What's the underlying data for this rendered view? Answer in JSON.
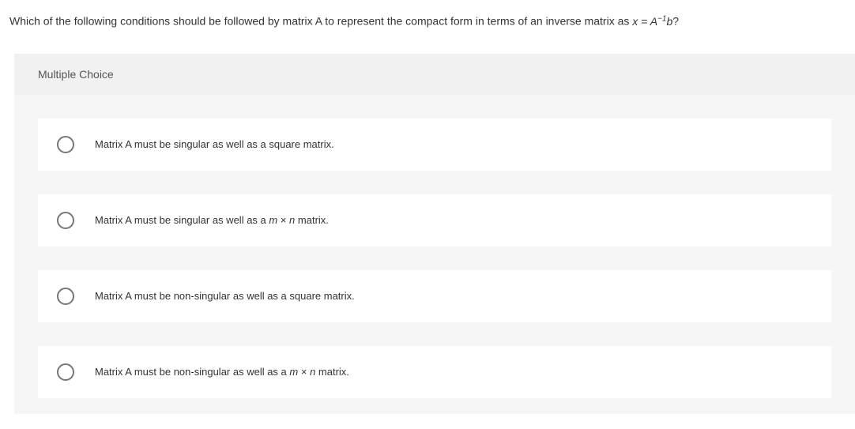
{
  "question": {
    "prefix": "Which of the following conditions should be followed by matrix A to represent the compact form in terms of an inverse matrix as ",
    "formula_x": "x",
    "formula_eq": " = ",
    "formula_A": "A",
    "formula_exp": "−1",
    "formula_b": "b",
    "suffix": "?"
  },
  "mc_label": "Multiple Choice",
  "options": [
    {
      "text": "Matrix A must be singular as well as a square matrix."
    },
    {
      "prefix": "Matrix A must be singular as well as a ",
      "m": "m",
      "times": " × ",
      "n": "n",
      "suffix": " matrix."
    },
    {
      "text": "Matrix A must be non-singular as well as a square matrix."
    },
    {
      "prefix": "Matrix A must be non-singular as well as a ",
      "m": "m",
      "times": " × ",
      "n": "n",
      "suffix": " matrix."
    }
  ]
}
